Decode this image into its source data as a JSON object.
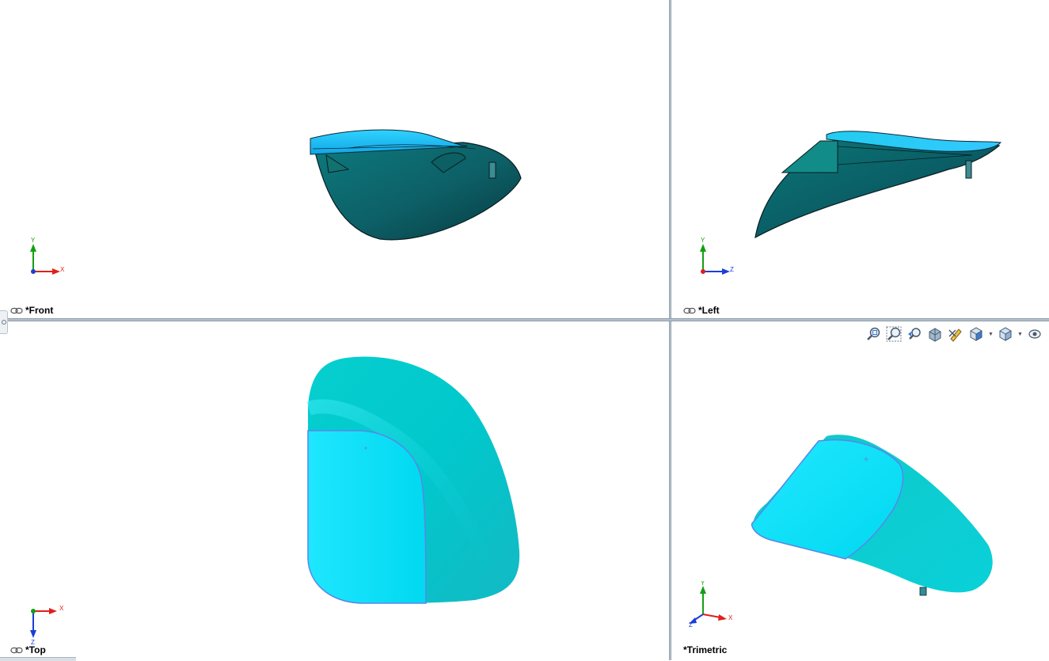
{
  "viewports": {
    "front": {
      "label": "*Front",
      "axis_h": "X",
      "axis_v": "Y"
    },
    "left": {
      "label": "*Left",
      "axis_h": "Z",
      "axis_v": "Y"
    },
    "top": {
      "label": "*Top",
      "axis_h": "X",
      "axis_v": "Z"
    },
    "trimetric": {
      "label": "*Trimetric",
      "axis_h": "X",
      "axis_v": "Y",
      "axis_d": "Z"
    }
  },
  "toolbar": {
    "items": [
      "zoom-to-fit-icon",
      "zoom-to-area-icon",
      "previous-view-icon",
      "section-view-icon",
      "dynamic-annotation-views-icon",
      "view-orientation-icon",
      "display-style-icon",
      "hide-show-items-icon"
    ]
  },
  "colors": {
    "part_light": "#00e0f5",
    "part_mid": "#00c9c9",
    "part_dark": "#0a4f57",
    "edge": "#1b2a35",
    "axis_x": "#e0201b",
    "axis_y": "#12a012",
    "axis_z": "#1b3fd6"
  }
}
